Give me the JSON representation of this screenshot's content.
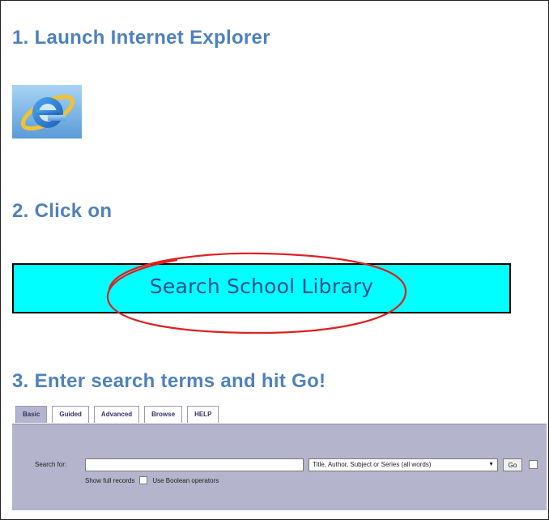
{
  "steps": {
    "step1": "1.  Launch Internet Explorer",
    "step2": "2.  Click on",
    "step3": "3.  Enter search terms and hit Go!"
  },
  "link": {
    "label": "Search School Library"
  },
  "icons": {
    "browser": "internet-explorer-icon",
    "annotation": "red-oval"
  },
  "colors": {
    "heading": "#4f81bd",
    "link_background": "#00ffff",
    "link_text": "#1f4e8a",
    "oval": "#e02020",
    "panel": "#b4b4cc"
  },
  "search": {
    "tabs": [
      "Basic",
      "Guided",
      "Advanced",
      "Browse",
      "HELP"
    ],
    "active_tab": "Basic",
    "search_for_label": "Search for:",
    "search_value": "",
    "field_select": "Title, Author, Subject or Series (all words)",
    "go_label": "Go",
    "show_full_records": "Show full records",
    "use_boolean": "Use Boolean operators"
  }
}
